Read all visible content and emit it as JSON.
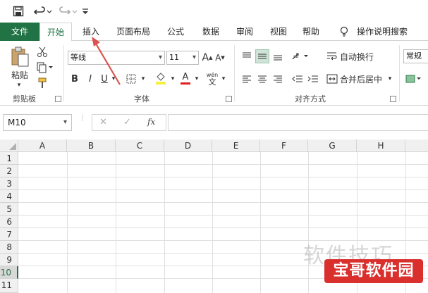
{
  "qat": {
    "save_icon": "save-icon",
    "undo_icon": "undo-icon",
    "redo_icon": "redo-icon",
    "customize_icon": "customize-qat-icon"
  },
  "tabs": {
    "file": "文件",
    "home": "开始",
    "insert": "插入",
    "page_layout": "页面布局",
    "formulas": "公式",
    "data": "数据",
    "review": "审阅",
    "view": "视图",
    "help": "帮助",
    "tell_me": "操作说明搜索"
  },
  "ribbon": {
    "clipboard": {
      "paste_label": "粘贴",
      "group_label": "剪贴板"
    },
    "font": {
      "font_name": "等线",
      "font_size": "11",
      "bold": "B",
      "italic": "I",
      "underline": "U",
      "grow": "A",
      "shrink": "A",
      "font_color_letter": "A",
      "phonetic": "wén",
      "phonetic_char": "文",
      "group_label": "字体"
    },
    "alignment": {
      "wrap_text": "自动换行",
      "merge_center": "合并后居中",
      "group_label": "对齐方式"
    },
    "number": {
      "format": "常规"
    }
  },
  "formula_bar": {
    "name_box": "M10",
    "cancel_glyph": "✕",
    "enter_glyph": "✓",
    "fx": "fx",
    "value": ""
  },
  "grid": {
    "columns": [
      "A",
      "B",
      "C",
      "D",
      "E",
      "F",
      "G",
      "H"
    ],
    "rows": [
      "1",
      "2",
      "3",
      "4",
      "5",
      "6",
      "7",
      "8",
      "9",
      "10",
      "11"
    ],
    "selected_row": "10"
  },
  "watermark": {
    "text": "软件技巧",
    "badge": "宝哥软件园"
  },
  "colors": {
    "accent": "#217346",
    "arrow": "#d9534f",
    "badge": "#d9302e"
  }
}
